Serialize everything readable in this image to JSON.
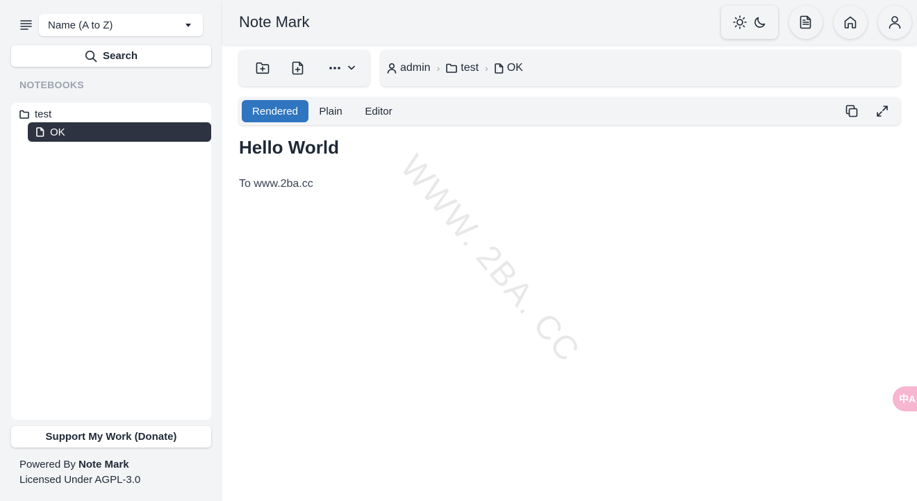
{
  "sidebar": {
    "sort_value": "Name (A to Z)",
    "search_label": "Search",
    "notebooks_heading": "NOTEBOOKS",
    "tree": {
      "folder": "test",
      "note": "OK"
    },
    "donate_label": "Support My Work (Donate)",
    "powered_by_prefix": "Powered By",
    "powered_by_name": "Note Mark",
    "license": "Licensed Under AGPL-3.0"
  },
  "header": {
    "title": "Note Mark",
    "icons": [
      "sun-icon",
      "moon-icon",
      "document-icon",
      "home-icon",
      "user-icon"
    ]
  },
  "toolbar": {
    "icons": [
      "folder-plus-icon",
      "file-plus-icon",
      "more-icon",
      "chevron-down-icon"
    ]
  },
  "breadcrumb": {
    "user": "admin",
    "notebook": "test",
    "note": "OK"
  },
  "view_tabs": [
    "Rendered",
    "Plain",
    "Editor"
  ],
  "active_tab": "Rendered",
  "note": {
    "heading": "Hello World",
    "body": "To www.2ba.cc"
  },
  "watermark": "WWW. 2BA. CC",
  "translate_button": "中A",
  "colors": {
    "accent": "#2f75c0",
    "selected_item": "#2d3340",
    "surface": "#f3f4f6"
  }
}
